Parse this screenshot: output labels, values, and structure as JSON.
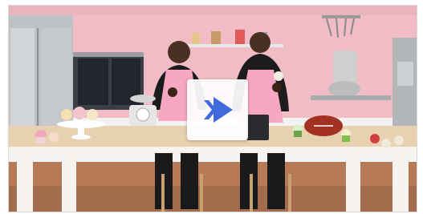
{
  "video": {
    "play_button": {
      "icon": "play-icon",
      "accent_color": "#3f6bdc"
    }
  }
}
